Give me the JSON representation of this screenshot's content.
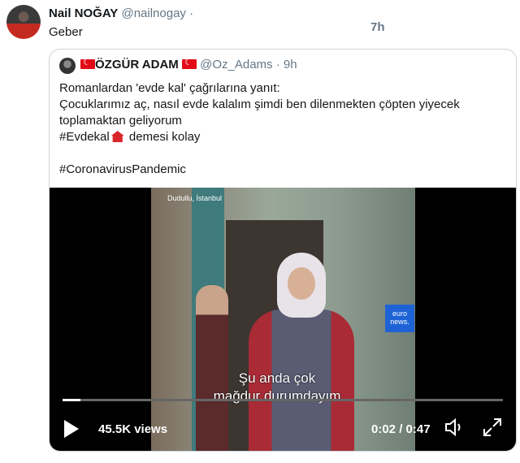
{
  "tweet": {
    "name": "Nail NOĞAY",
    "handle": "@nailnogay",
    "dot": "·",
    "time": "7h",
    "text": "Geber"
  },
  "quote": {
    "name": "ÖZGÜR ADAM",
    "handle": "@Oz_Adams",
    "dot": "·",
    "time": "9h",
    "lines": [
      "Romanlardan 'evde kal' çağrılarına yanıt:",
      "Çocuklarımız aç, nasıl evde kalalım şimdi ben dilenmekten çöpten yiyecek toplamaktan geliyorum"
    ],
    "hashtag1": "#Evdekal",
    "hashtag1_suffix": "demesi kolay",
    "hashtag2": "#CoronavirusPandemic"
  },
  "video": {
    "location": "Dudullu, İstanbul",
    "brand": "euro news.",
    "subtitle_line1": "Şu anda çok",
    "subtitle_line2": "mağdur durumdayım",
    "views": "45.5K views",
    "time": "0:02 / 0:47",
    "progress": 0.04
  },
  "icons": {
    "play": "play-icon",
    "volume": "volume-icon",
    "fullscreen": "fullscreen-icon"
  }
}
